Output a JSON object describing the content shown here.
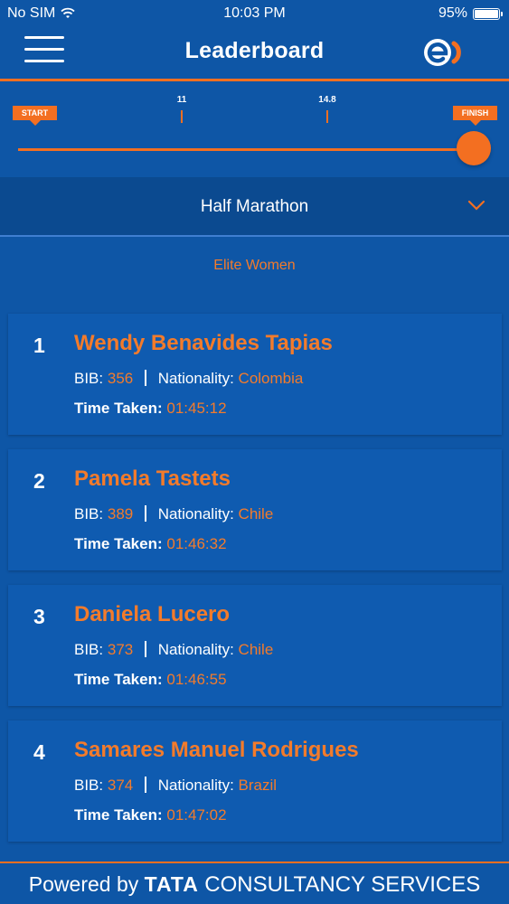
{
  "status_bar": {
    "carrier": "No SIM",
    "time": "10:03 PM",
    "battery": "95%",
    "battery_level": 0.95
  },
  "header": {
    "title": "Leaderboard",
    "menu_icon": "hamburger-menu-icon",
    "logo_icon": "entel-logo-icon"
  },
  "progress": {
    "start_label": "START",
    "finish_label": "FINISH",
    "markers": [
      "11",
      "14.8"
    ],
    "position_fraction": 1.0
  },
  "race_selector": {
    "selected": "Half Marathon",
    "icon": "chevron-down-icon"
  },
  "category": "Elite Women",
  "labels": {
    "bib": "BIB:",
    "nationality": "Nationality:",
    "time_taken": "Time Taken:"
  },
  "results": [
    {
      "rank": "1",
      "name": "Wendy Benavides Tapias",
      "bib": "356",
      "nationality": "Colombia",
      "time": "01:45:12"
    },
    {
      "rank": "2",
      "name": "Pamela Tastets",
      "bib": "389",
      "nationality": "Chile",
      "time": "01:46:32"
    },
    {
      "rank": "3",
      "name": "Daniela Lucero",
      "bib": "373",
      "nationality": "Chile",
      "time": "01:46:55"
    },
    {
      "rank": "4",
      "name": "Samares Manuel Rodrigues",
      "bib": "374",
      "nationality": "Brazil",
      "time": "01:47:02"
    }
  ],
  "footer": {
    "powered_by": "Powered by",
    "brand": "TATA",
    "company": "CONSULTANCY SERVICES"
  },
  "colors": {
    "background": "#0e56a6",
    "accent": "#f36f21",
    "card": "#0f5bb0",
    "selector": "#0b4a90"
  }
}
